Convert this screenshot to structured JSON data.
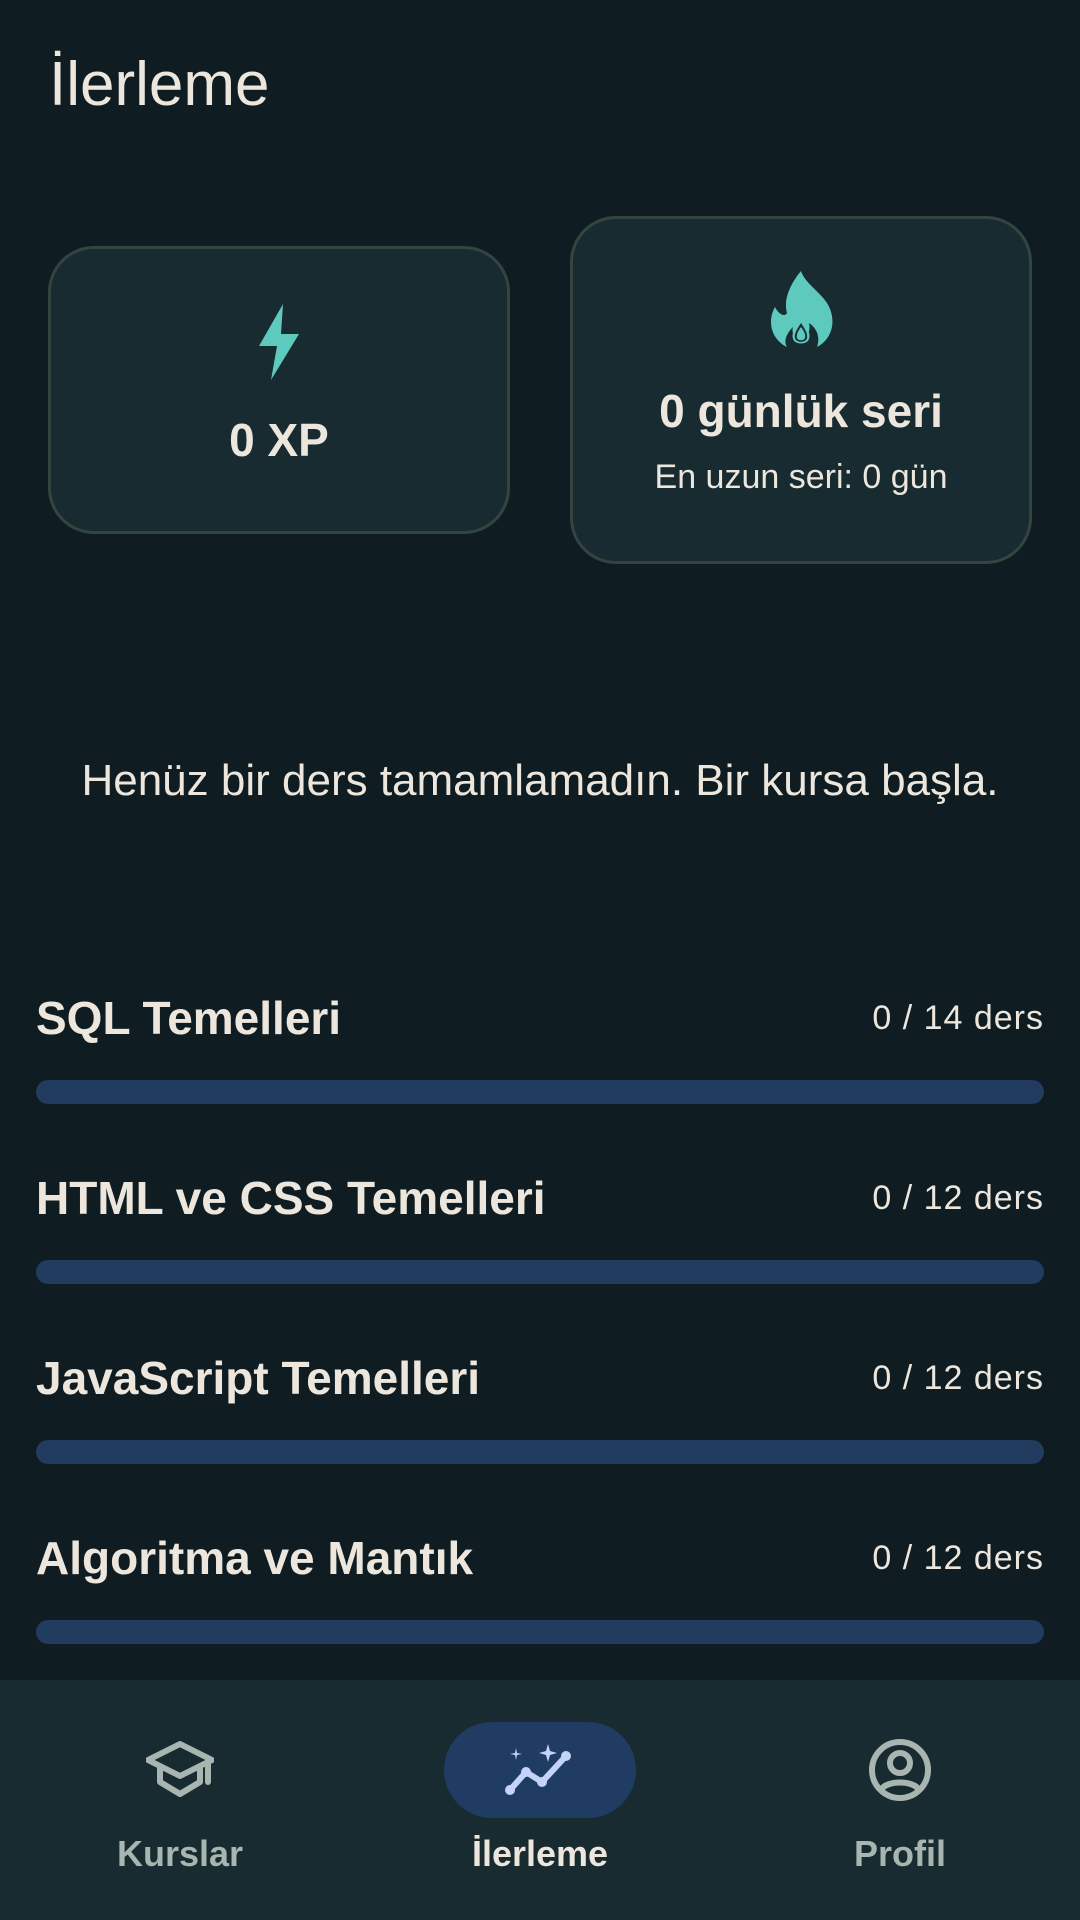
{
  "header": {
    "title": "İlerleme"
  },
  "stats": {
    "xp": {
      "icon": "lightning-icon",
      "value": "0 XP"
    },
    "streak": {
      "icon": "flame-icon",
      "value": "0 günlük seri",
      "longest": "En uzun seri: 0 gün"
    }
  },
  "empty_message": "Henüz bir ders tamamlamadın. Bir kursa başla.",
  "courses": [
    {
      "name": "SQL Temelleri",
      "count": "0 / 14 ders",
      "completed": 0,
      "total": 14
    },
    {
      "name": "HTML ve CSS Temelleri",
      "count": "0 / 12 ders",
      "completed": 0,
      "total": 12
    },
    {
      "name": "JavaScript Temelleri",
      "count": "0 / 12 ders",
      "completed": 0,
      "total": 12
    },
    {
      "name": "Algoritma ve Mantık",
      "count": "0 / 12 ders",
      "completed": 0,
      "total": 12
    }
  ],
  "nav": {
    "items": [
      {
        "label": "Kurslar",
        "icon": "graduation-cap-icon",
        "active": false
      },
      {
        "label": "İlerleme",
        "icon": "progress-chart-icon",
        "active": true
      },
      {
        "label": "Profil",
        "icon": "account-circle-icon",
        "active": false
      }
    ]
  },
  "colors": {
    "background": "#0f1d22",
    "card": "#172b30",
    "accent": "#5ec9bd",
    "progress_track": "#223c60",
    "nav_active_pill": "#213c63",
    "text": "#ece6dc"
  }
}
